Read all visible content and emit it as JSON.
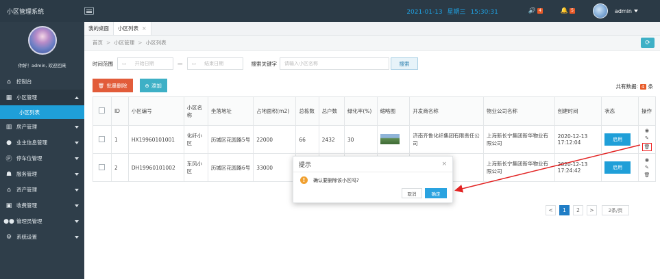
{
  "header": {
    "app_title": "小区管理系统",
    "date": "2021-01-13",
    "weekday": "星期三",
    "time": "15:30:31",
    "volume_count": "4",
    "bell_count": "5",
    "user": "admin"
  },
  "sidebar": {
    "welcome": "你好！admin, 欢迎回来",
    "items": [
      {
        "label": "控制台"
      },
      {
        "label": "小区管理"
      },
      {
        "label": "小区列表"
      },
      {
        "label": "房产管理"
      },
      {
        "label": "业主信息管理"
      },
      {
        "label": "停车位管理"
      },
      {
        "label": "服务管理"
      },
      {
        "label": "资产管理"
      },
      {
        "label": "收费管理"
      },
      {
        "label": "管理员管理"
      },
      {
        "label": "系统设置"
      }
    ]
  },
  "tabs": [
    {
      "label": "我的桌面"
    },
    {
      "label": "小区列表"
    }
  ],
  "breadcrumb": [
    "首页",
    "小区管理",
    "小区列表"
  ],
  "search": {
    "range_label": "时间范围",
    "start_placeholder": "开始日期",
    "dash": "—",
    "end_placeholder": "结束日期",
    "keyword_label": "搜索关键字",
    "keyword_placeholder": "请输入小区名称",
    "search_button": "搜索"
  },
  "actions": {
    "bulk_delete": "批量删除",
    "add": "添加",
    "total_label": "共有数据:",
    "total_count": "4",
    "total_unit": "条"
  },
  "table": {
    "headers": [
      "ID",
      "小区编号",
      "小区名称",
      "坐落地址",
      "占地面积(m2)",
      "总栋数",
      "总户数",
      "绿化率(%)",
      "缩略图",
      "开发商名称",
      "物业公司名称",
      "创建时间",
      "状态",
      "操作"
    ],
    "rows": [
      {
        "id": "1",
        "code": "HX19960101001",
        "name": "化纤小区",
        "address": "历城区花园路5号",
        "area": "22000",
        "buildings": "66",
        "households": "2432",
        "green": "30",
        "developer": "济南齐鲁化纤集团有限责任公司",
        "property": "上海新长宁集团新华物业有限公司",
        "created": "2020-12-13 17:12:04",
        "status": "启用"
      },
      {
        "id": "2",
        "code": "DH19960101002",
        "name": "东风小区",
        "address": "历城区花园路6号",
        "area": "33000",
        "buildings": "",
        "households": "",
        "green": "",
        "developer": "",
        "property": "上海新长宁集团新华物业有限公司",
        "created": "2020-12-13 17:24:42",
        "status": "启用"
      }
    ]
  },
  "pagination": {
    "prev": "<",
    "pages": [
      "1",
      "2"
    ],
    "next": ">",
    "per_page": "2条/页"
  },
  "modal": {
    "title": "提示",
    "message": "确认要删除该小区吗?",
    "cancel": "取消",
    "ok": "确定"
  },
  "colors": {
    "accent": "#1f9fd8",
    "danger": "#e25c3a",
    "annotation": "#e22222"
  }
}
